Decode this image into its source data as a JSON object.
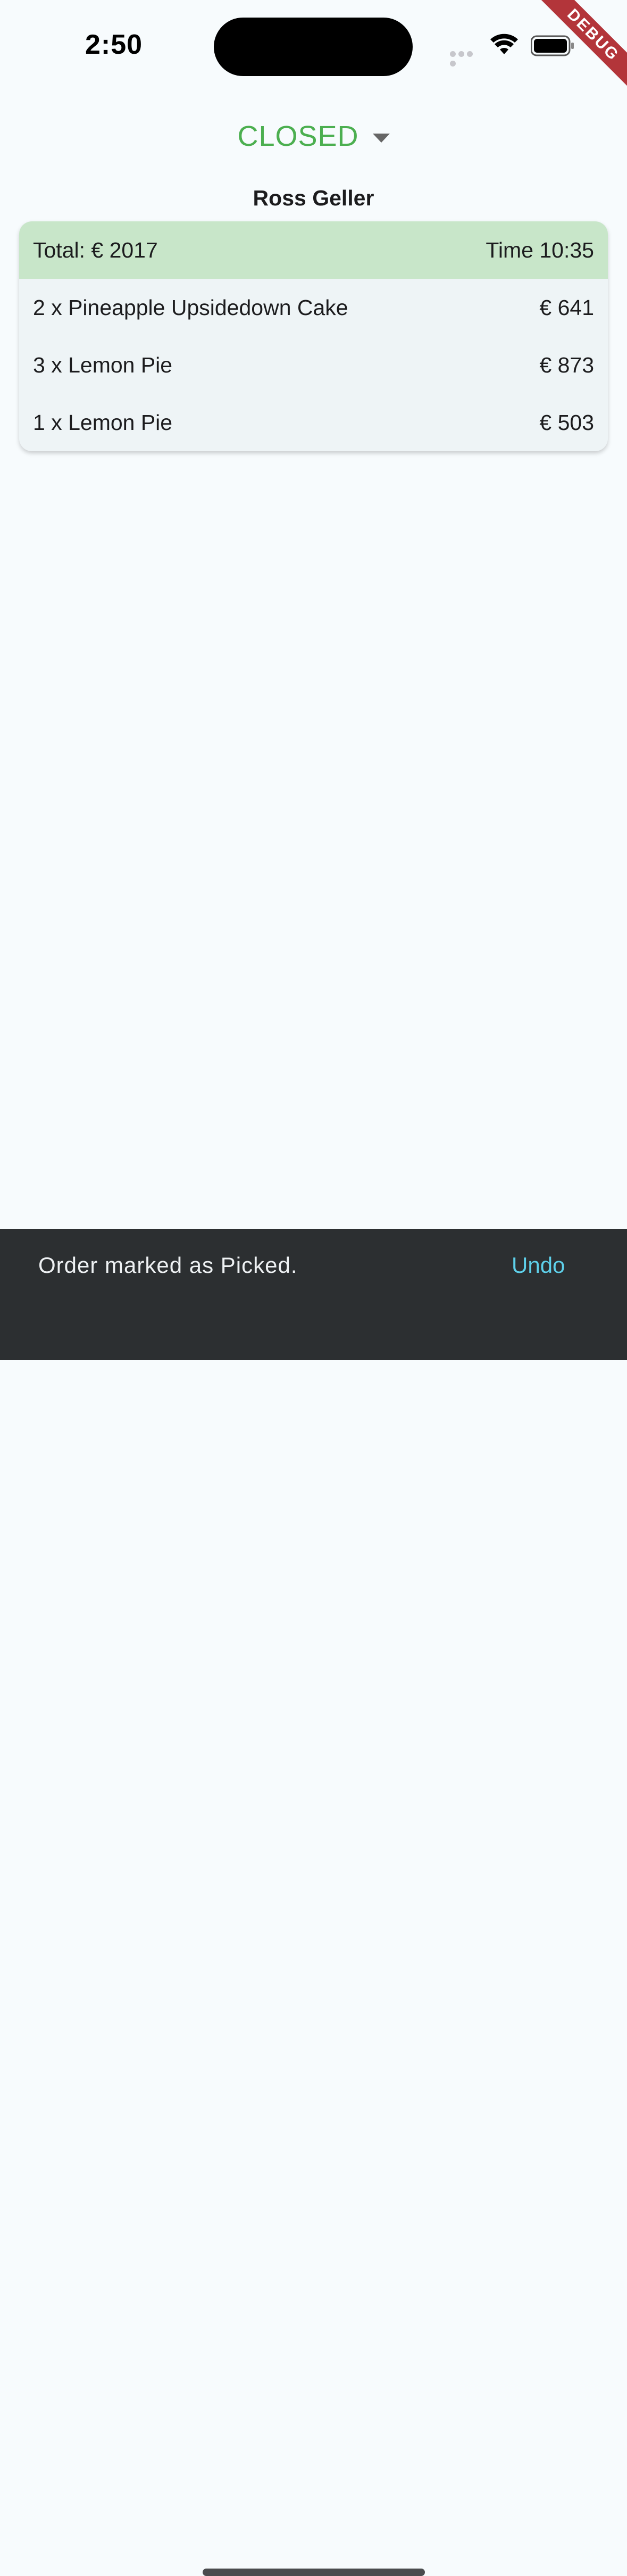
{
  "status_bar": {
    "time": "2:50",
    "debug_label": "DEBUG"
  },
  "order_status": {
    "selected": "CLOSED",
    "color": "#4caf50"
  },
  "customer": {
    "name": "Ross Geller"
  },
  "order": {
    "total_label": "Total: € 2017",
    "time_label": "Time 10:35",
    "items": [
      {
        "description": "2 x Pineapple Upsidedown Cake",
        "price": "€ 641"
      },
      {
        "description": "3 x Lemon Pie",
        "price": "€ 873"
      },
      {
        "description": "1 x Lemon Pie",
        "price": "€ 503"
      }
    ]
  },
  "snackbar": {
    "message": "Order marked as Picked.",
    "action_label": "Undo",
    "action_color": "#5ed0ea"
  },
  "colors": {
    "background": "#f7fbfd",
    "card_header": "#c8e6c9",
    "card_body": "#eef4f6",
    "snackbar": "#2c2f31",
    "debug_ribbon": "#b3353a"
  }
}
